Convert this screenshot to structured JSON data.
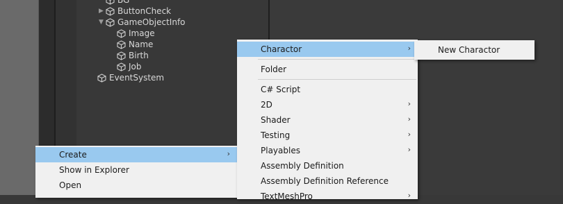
{
  "hierarchy": {
    "items": [
      {
        "label": "BG"
      },
      {
        "label": "ButtonCheck"
      },
      {
        "label": "GameObjectInfo"
      },
      {
        "label": "Image"
      },
      {
        "label": "Name"
      },
      {
        "label": "Birth"
      },
      {
        "label": "Job"
      },
      {
        "label": "EventSystem"
      }
    ]
  },
  "context_menu": {
    "create": "Create",
    "show_in_explorer": "Show in Explorer",
    "open": "Open"
  },
  "create_menu": {
    "charactor": "Charactor",
    "folder": "Folder",
    "csharp_script": "C# Script",
    "2d": "2D",
    "shader": "Shader",
    "testing": "Testing",
    "playables": "Playables",
    "assembly_definition": "Assembly Definition",
    "assembly_definition_reference": "Assembly Definition Reference",
    "textmeshpro": "TextMeshPro"
  },
  "charactor_menu": {
    "new_charactor": "New Charactor"
  },
  "colors": {
    "highlight": "#99c9ef",
    "menu_bg": "#f0f0f0",
    "editor_bg": "#383838"
  }
}
